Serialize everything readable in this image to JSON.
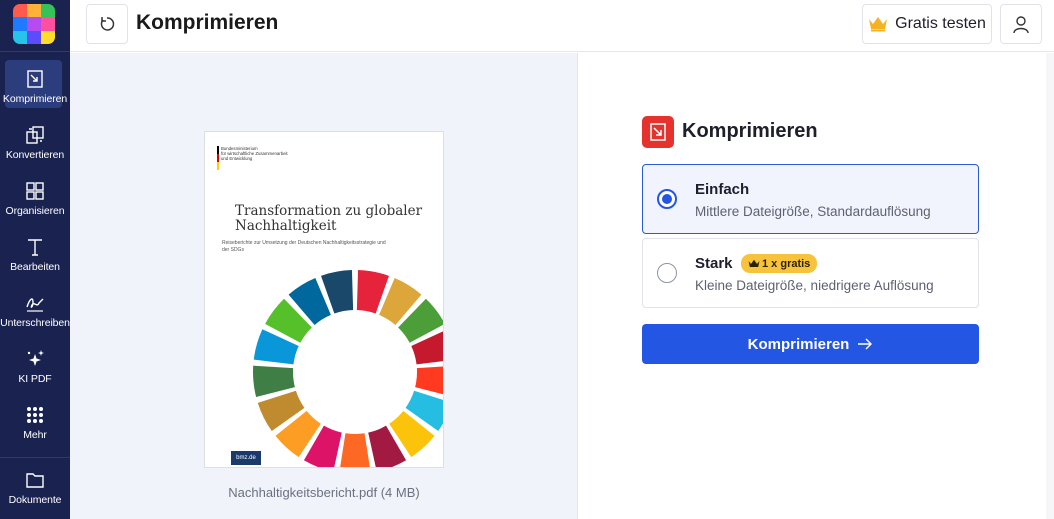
{
  "app": {
    "logo_colors": [
      "#ff5a4e",
      "#ffb238",
      "#36c25b",
      "#1e7bff",
      "#b54cf2",
      "#ff4fa0",
      "#26c4e8",
      "#5d4bff",
      "#ffdd2b"
    ]
  },
  "sidebar": {
    "items": [
      {
        "label": "Komprimieren",
        "icon": "compress-icon",
        "active": true
      },
      {
        "label": "Konvertieren",
        "icon": "convert-icon",
        "active": false
      },
      {
        "label": "Organisieren",
        "icon": "grid-icon",
        "active": false
      },
      {
        "label": "Bearbeiten",
        "icon": "text-edit-icon",
        "active": false
      },
      {
        "label": "Unterschreiben",
        "icon": "signature-icon",
        "active": false
      },
      {
        "label": "KI PDF",
        "icon": "sparkle-icon",
        "active": false
      },
      {
        "label": "Mehr",
        "icon": "dots-grid-icon",
        "active": false
      }
    ],
    "documents_label": "Dokumente"
  },
  "header": {
    "title": "Komprimieren",
    "back_icon": "undo-icon",
    "trial_label": "Gratis testen",
    "trial_icon": "crown-icon",
    "user_icon": "user-icon"
  },
  "preview": {
    "file_name": "Nachhaltigkeitsbericht.pdf (4 MB)",
    "doc": {
      "gov_text": "Bundesministerium\nfür wirtschaftliche Zusammenarbeit\nund Entwicklung",
      "title": "Transformation zu globaler Nachhaltigkeit",
      "subtitle": "Reiseberichte zur Umsetzung der Deutschen Nachhaltigkeitsstrategie und der SDGs",
      "badge": "bmz.de"
    }
  },
  "options_panel": {
    "title": "Komprimieren",
    "options": [
      {
        "name": "Einfach",
        "description": "Mittlere Dateigröße, Standardauflösung",
        "selected": true
      },
      {
        "name": "Stark",
        "description": "Kleine Dateigröße, niedrigere Auflösung",
        "selected": false,
        "badge": "1 x gratis"
      }
    ],
    "submit_label": "Komprimieren",
    "accent_color": "#2456e4",
    "tool_color": "#e5322d",
    "badge_color": "#f7c33d"
  }
}
